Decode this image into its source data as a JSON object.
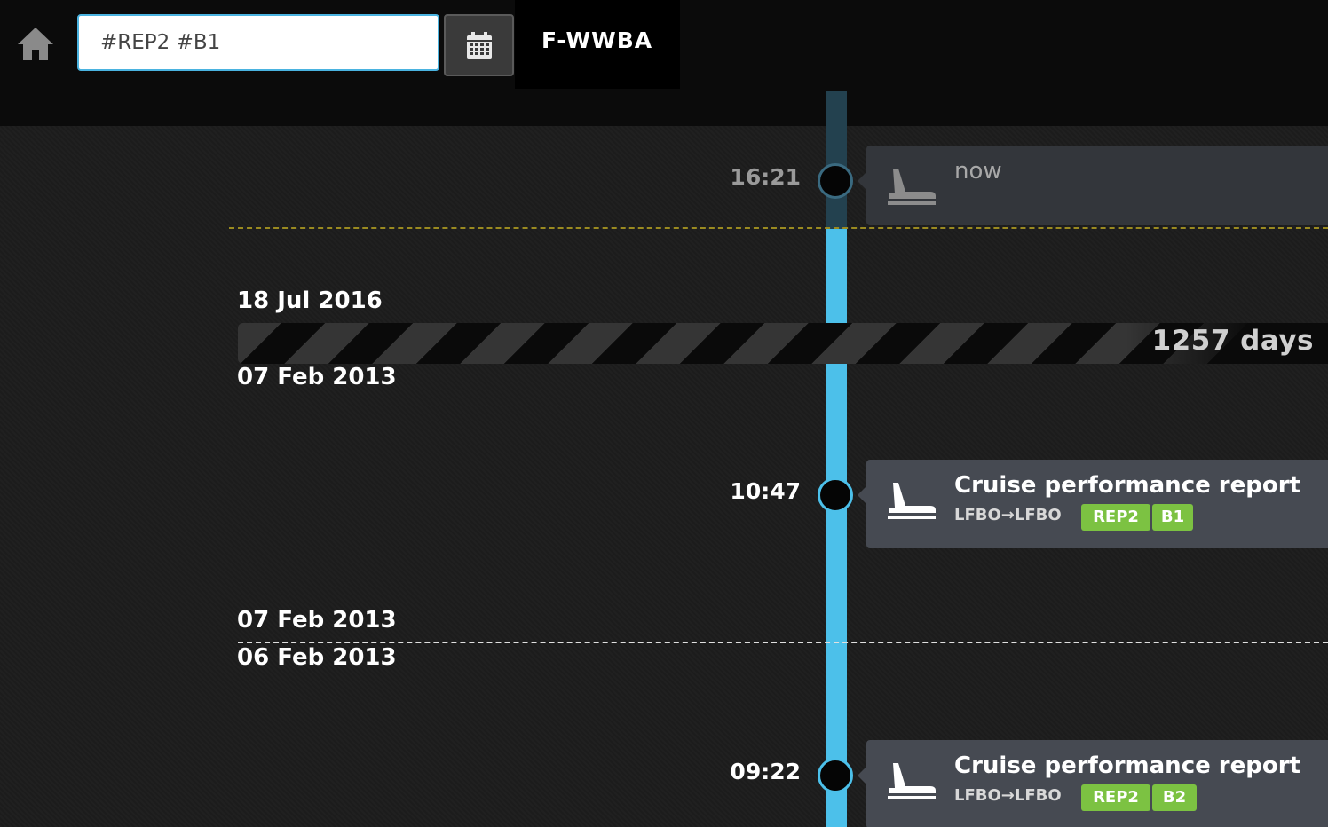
{
  "header": {
    "search_value": "#REP2 #B1",
    "registration": "F-WWBA"
  },
  "icons": {
    "home": "home-icon",
    "calendar": "calendar-icon",
    "plane": "plane-takeoff-icon"
  },
  "colors": {
    "accent": "#4cc0ea",
    "tag": "#7cc242",
    "now_line": "#9a8a20"
  },
  "timeline": {
    "now": {
      "time": "16:21",
      "label": "now"
    },
    "gap": {
      "end_date": "18 Jul 2016",
      "start_date": "07 Feb 2013",
      "days": "1257 days"
    },
    "events": [
      {
        "time": "10:47",
        "title": "Cruise performance report",
        "route": "LFBO→LFBO",
        "tags": [
          "REP2",
          "B1"
        ]
      },
      {
        "time": "09:22",
        "title": "Cruise performance report",
        "route": "LFBO→LFBO",
        "tags": [
          "REP2",
          "B2"
        ]
      }
    ],
    "day_separator": {
      "upper": "07 Feb 2013",
      "lower": "06 Feb 2013"
    }
  }
}
